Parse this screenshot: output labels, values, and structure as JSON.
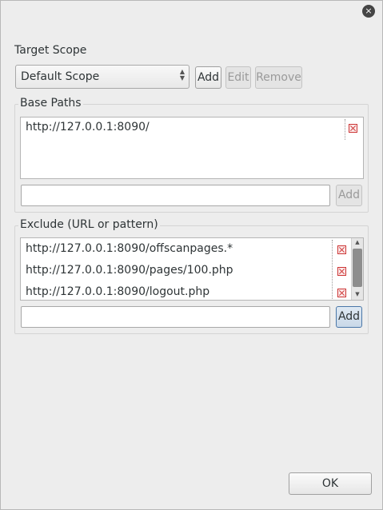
{
  "dialog": {
    "close_glyph": "×",
    "target_scope_label": "Target Scope",
    "scope_select_value": "Default Scope",
    "add_label": "Add",
    "edit_label": "Edit",
    "remove_label": "Remove",
    "ok_label": "OK"
  },
  "base_paths": {
    "title": "Base Paths",
    "items": [
      "http://127.0.0.1:8090/"
    ],
    "input_value": "",
    "add_label": "Add"
  },
  "exclude": {
    "title": "Exclude (URL or pattern)",
    "items": [
      "http://127.0.0.1:8090/offscanpages.*",
      "http://127.0.0.1:8090/pages/100.php",
      "http://127.0.0.1:8090/logout.php"
    ],
    "input_value": "",
    "add_label": "Add"
  },
  "icons": {
    "close": "close-icon",
    "delete": "delete-icon",
    "combo_arrows": "up-down-arrows-icon",
    "scroll_up": "scroll-up-arrow-icon",
    "scroll_down": "scroll-down-arrow-icon"
  }
}
